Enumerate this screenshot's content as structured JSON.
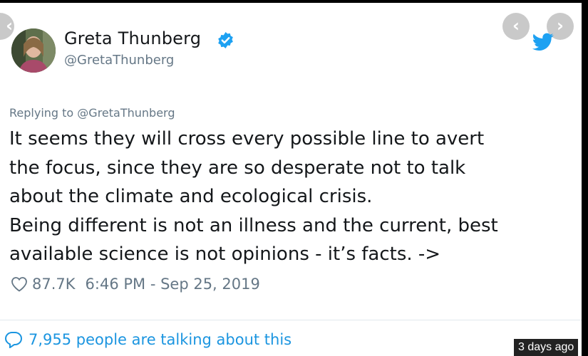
{
  "tweet": {
    "display_name": "Greta Thunberg",
    "handle": "@GretaThunberg",
    "replying_to": "Replying to @GretaThunberg",
    "text_lines": [
      "It seems they will cross every possible line to avert",
      "the focus, since they are so desperate not to talk",
      "about the climate and ecological crisis.",
      "Being different is not an illness and the current, best",
      "available science is not opinions - it’s facts. ->"
    ],
    "likes": "87.7K",
    "timestamp": "6:46 PM - Sep 25, 2019",
    "talking": "7,955 people are talking about this"
  },
  "overlay": {
    "age_badge": "3 days ago",
    "prev_glyph": "‹",
    "next_glyph": "›"
  },
  "colors": {
    "text": "#14171a",
    "secondary": "#657786",
    "link": "#1b95e0",
    "twitter_blue": "#1da1f2",
    "nav_button": "#c9c9c9"
  },
  "icons": [
    "verified-badge-icon",
    "twitter-bird-icon",
    "heart-icon",
    "speech-bubble-icon",
    "chevron-left-icon",
    "chevron-right-icon"
  ]
}
